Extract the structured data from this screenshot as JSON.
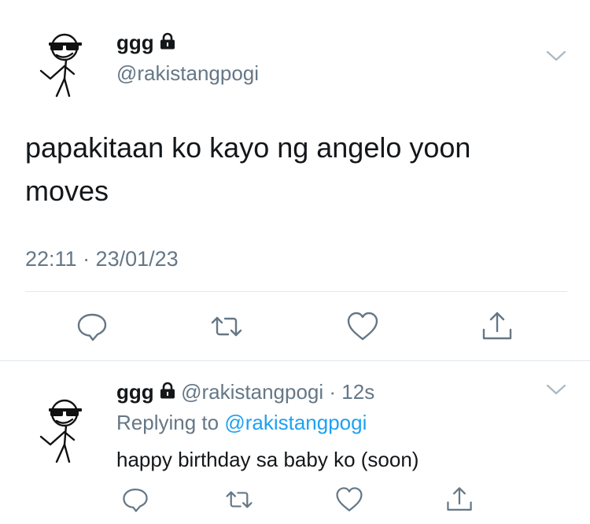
{
  "tweet": {
    "display_name": "ggg",
    "handle": "@rakistangpogi",
    "text": "papakitaan ko kayo ng angelo yoon moves",
    "timestamp": "22:11 · 23/01/23"
  },
  "reply": {
    "display_name": "ggg",
    "handle": "@rakistangpogi",
    "separator": " · ",
    "time_ago": "12s",
    "replying_prefix": "Replying to ",
    "replying_handle": "@rakistangpogi",
    "text": "happy birthday sa baby ko (soon)"
  },
  "icons": {
    "protected": "lock-icon",
    "more": "chevron-down-icon",
    "reply": "reply-icon",
    "retweet": "retweet-icon",
    "like": "heart-icon",
    "share": "share-icon"
  },
  "colors": {
    "text": "#14171a",
    "muted": "#657786",
    "link": "#1da1f2",
    "divider": "#e1e8ed"
  }
}
